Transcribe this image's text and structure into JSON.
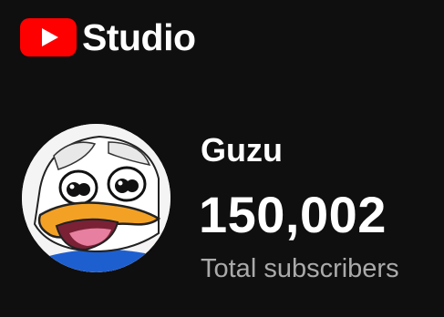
{
  "header": {
    "brand_label": "Studio",
    "logo_icon": "youtube-play-icon",
    "logo_color": "#ff0000"
  },
  "channel": {
    "name": "Guzu",
    "subscriber_count": "150,002",
    "subscriber_label": "Total subscribers",
    "avatar_icon": "duck-meme-avatar"
  },
  "colors": {
    "background": "#0f0f0f",
    "primary_text": "#ffffff",
    "secondary_text": "#aaaaaa"
  }
}
